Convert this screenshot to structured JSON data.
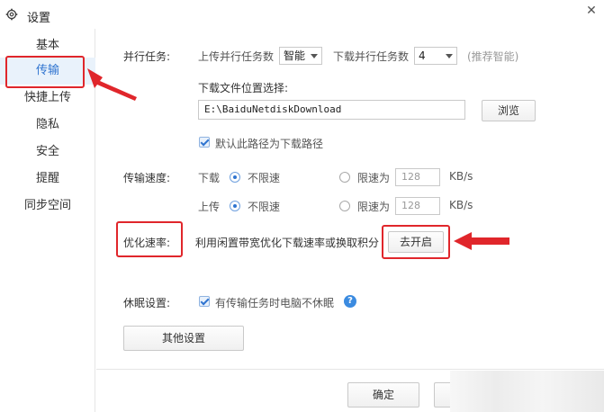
{
  "window": {
    "title": "设置",
    "close_glyph": "✕"
  },
  "sidebar": {
    "items": [
      {
        "label": "基本"
      },
      {
        "label": "传输"
      },
      {
        "label": "快捷上传"
      },
      {
        "label": "隐私"
      },
      {
        "label": "安全"
      },
      {
        "label": "提醒"
      },
      {
        "label": "同步空间"
      }
    ],
    "active_index": 1
  },
  "parallel": {
    "label": "并行任务:",
    "upload_label": "上传并行任务数",
    "upload_value": "智能",
    "download_label": "下载并行任务数",
    "download_value": "4",
    "hint": "(推荐智能)"
  },
  "download_location": {
    "label": "下载文件位置选择:",
    "path": "E:\\BaiduNetdiskDownload",
    "browse_button": "浏览",
    "default_checkbox_label": "默认此路径为下载路径"
  },
  "speed": {
    "label": "传输速度:",
    "download": {
      "label": "下载",
      "unlimited": "不限速",
      "limit_label": "限速为",
      "limit_value": "128",
      "unit": "KB/s"
    },
    "upload": {
      "label": "上传",
      "unlimited": "不限速",
      "limit_label": "限速为",
      "limit_value": "128",
      "unit": "KB/s"
    }
  },
  "optimize": {
    "label": "优化速率:",
    "description": "利用闲置带宽优化下载速率或换取积分",
    "button": "去开启"
  },
  "sleep": {
    "label": "休眠设置:",
    "checkbox_label": "有传输任务时电脑不休眠",
    "help_glyph": "?"
  },
  "other_button": "其他设置",
  "footer": {
    "ok_button": "确定"
  },
  "colors": {
    "accent": "#2f74d0",
    "annotation_red": "#e0262b"
  }
}
